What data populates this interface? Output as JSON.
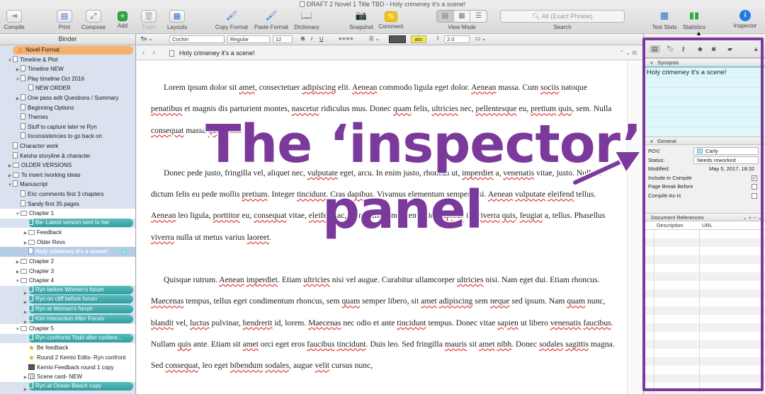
{
  "window": {
    "title": "DRAFT 2 Novel 1 Title TBD - Holy crimeney it's a scene!"
  },
  "toolbar": {
    "compile": "Compile",
    "print": "Print",
    "compose": "Compose",
    "add": "Add",
    "trash": "Trash",
    "layouts": "Layouts",
    "copy_format": "Copy Format",
    "paste_format": "Paste Format",
    "dictionary": "Dictionary",
    "snapshot": "Snapshot",
    "comment": "Comment",
    "view_mode": "View Mode",
    "search_placeholder": "All (Exact Phrase)",
    "search_label": "Search",
    "text_stats": "Text Stats",
    "statistics": "Statistics",
    "inspector": "Inspector",
    "icons": {
      "compile": "compile-icon",
      "print": "printer-icon",
      "compose": "compose-icon",
      "add": "plus-icon",
      "trash": "trash-icon",
      "layouts": "layouts-icon",
      "copy_format": "brush-icon",
      "paste_format": "brush-icon",
      "dictionary": "book-icon",
      "snapshot": "camera-icon",
      "comment": "speech-bubble-icon",
      "text_stats": "calculator-icon",
      "statistics": "bar-chart-icon",
      "inspector": "info-icon"
    }
  },
  "binder": {
    "title": "Binder",
    "items": [
      {
        "label": "Novel Format",
        "indent": 0,
        "disc": "",
        "icon": "warn",
        "style": "pill-orange"
      },
      {
        "label": "Timeline & Plot",
        "indent": 0,
        "disc": "▼",
        "icon": "doc",
        "style": ""
      },
      {
        "label": "Timeline NEW",
        "indent": 1,
        "disc": "▶",
        "icon": "doc",
        "style": ""
      },
      {
        "label": "Play timeline Oct 2016",
        "indent": 1,
        "disc": "▼",
        "icon": "doc",
        "style": ""
      },
      {
        "label": "NEW ORDER",
        "indent": 2,
        "disc": "",
        "icon": "doc",
        "style": ""
      },
      {
        "label": "One pass edit Questions / Summary",
        "indent": 1,
        "disc": "▶",
        "icon": "doc",
        "style": ""
      },
      {
        "label": "Beginning Options",
        "indent": 1,
        "disc": "",
        "icon": "doc",
        "style": ""
      },
      {
        "label": "Themes",
        "indent": 1,
        "disc": "",
        "icon": "doc",
        "style": ""
      },
      {
        "label": "Stuff to capture later re Ryn",
        "indent": 1,
        "disc": "",
        "icon": "doc",
        "style": ""
      },
      {
        "label": "Inconsistencies to go back on",
        "indent": 1,
        "disc": "",
        "icon": "doc",
        "style": ""
      },
      {
        "label": "Character work",
        "indent": 0,
        "disc": "",
        "icon": "doc",
        "style": ""
      },
      {
        "label": "Keisha storyline & character",
        "indent": 0,
        "disc": "",
        "icon": "doc",
        "style": ""
      },
      {
        "label": "OLDER VERSIONS",
        "indent": 0,
        "disc": "▶",
        "icon": "folder",
        "style": ""
      },
      {
        "label": "To insert /working ideas",
        "indent": 0,
        "disc": "▶",
        "icon": "folder",
        "style": ""
      },
      {
        "label": "Manuscript",
        "indent": 0,
        "disc": "▼",
        "icon": "doc",
        "style": ""
      },
      {
        "label": "Eric comments first 3 chapters",
        "indent": 1,
        "disc": "",
        "icon": "doc",
        "style": ""
      },
      {
        "label": "Sandy first 35 pages",
        "indent": 1,
        "disc": "",
        "icon": "doc",
        "style": ""
      },
      {
        "label": "Chapter 1",
        "indent": 1,
        "disc": "▼",
        "icon": "folder",
        "style": "white-row"
      },
      {
        "label": "Be- Latest version sent to her",
        "indent": 2,
        "disc": "",
        "icon": "doc",
        "style": "pill-teal"
      },
      {
        "label": "Feedback",
        "indent": 2,
        "disc": "▶",
        "icon": "folder",
        "style": "white-row"
      },
      {
        "label": "Older Revs",
        "indent": 2,
        "disc": "▶",
        "icon": "folder",
        "style": "white-row"
      },
      {
        "label": "Holy crimeney it's a scene!",
        "indent": 2,
        "disc": "",
        "icon": "blue",
        "style": "selected"
      },
      {
        "label": "Chapter 2",
        "indent": 1,
        "disc": "▶",
        "icon": "folder",
        "style": "white-row"
      },
      {
        "label": "Chapter 3",
        "indent": 1,
        "disc": "▶",
        "icon": "folder",
        "style": "white-row"
      },
      {
        "label": "Chapter 4",
        "indent": 1,
        "disc": "▼",
        "icon": "folder",
        "style": "white-row"
      },
      {
        "label": "Ryn before Women's forum",
        "indent": 2,
        "disc": "▶",
        "icon": "doc",
        "style": "pill-teal"
      },
      {
        "label": "Ryn on cliff before forum",
        "indent": 2,
        "disc": "▶",
        "icon": "doc",
        "style": "pill-teal"
      },
      {
        "label": "Ryn at Woman's forum",
        "indent": 2,
        "disc": "▶",
        "icon": "doc",
        "style": "pill-teal"
      },
      {
        "label": "Kim Interaction After Forum",
        "indent": 2,
        "disc": "▶",
        "icon": "doc",
        "style": "pill-teal"
      },
      {
        "label": "Chapter 5",
        "indent": 1,
        "disc": "▼",
        "icon": "folder",
        "style": "white-row"
      },
      {
        "label": "Ryn confronts Todd after confere...",
        "indent": 2,
        "disc": "",
        "icon": "doc",
        "style": "pill-teal"
      },
      {
        "label": "Be feedback",
        "indent": 2,
        "disc": "",
        "icon": "star",
        "style": "white-row"
      },
      {
        "label": "Round 2 Kemio Edits- Ryn confront",
        "indent": 2,
        "disc": "",
        "icon": "star",
        "style": "white-row"
      },
      {
        "label": "Kemio Feedback round 1 copy",
        "indent": 2,
        "disc": "",
        "icon": "dark",
        "style": "white-row"
      },
      {
        "label": "Scene card- NEW",
        "indent": 2,
        "disc": "▶",
        "icon": "grid",
        "style": "white-row"
      },
      {
        "label": "Ryn at Ocean Beach copy",
        "indent": 2,
        "disc": "▶",
        "icon": "doc",
        "style": "pill-teal"
      }
    ]
  },
  "format_bar": {
    "paragraph_style": "¶a",
    "font": "Cochin",
    "weight": "Regular",
    "size": "12",
    "bold": "B",
    "italic": "I",
    "underline": "U",
    "highlight": "abc",
    "line_spacing": "2.0"
  },
  "editor": {
    "doc_title": "Holy crimeney it's a scene!",
    "paragraphs": [
      "Lorem ipsum dolor sit amet, consectetuer adipiscing elit. Aenean commodo ligula eget dolor. Aenean massa. Cum sociis natoque penatibus et magnis dis parturient montes, nascetur ridiculus mus. Donec quam felis, ultricies nec, pellentesque eu, pretium quis, sem. Nulla consequat massa quis enim.",
      "Donec pede justo, fringilla vel, aliquet nec, vulputate eget, arcu. In enim justo, rhoncus ut, imperdiet a, venenatis vitae, justo. Nullam dictum felis eu pede mollis pretium. Integer tincidunt. Cras dapibus. Vivamus elementum semper nisi. Aenean vulputate eleifend tellus. Aenean leo ligula, porttitor eu, consequat vitae, eleifend ac, enim. Aliquam lorem ante, dapibus in, viverra quis, feugiat a, tellus. Phasellus viverra nulla ut metus varius laoreet.",
      "Quisque rutrum. Aenean imperdiet. Etiam ultricies nisi vel augue. Curabitur ullamcorper ultricies nisi. Nam eget dui. Etiam rhoncus. Maecenas tempus, tellus eget condimentum rhoncus, sem quam semper libero, sit amet adipiscing sem neque sed ipsum. Nam quam nunc, blandit vel, luctus pulvinar, hendrerit id, lorem. Maecenas nec odio et ante tincidunt tempus. Donec vitae sapien ut libero venenatis faucibus. Nullam quis ante. Etiam sit amet orci eget eros faucibus tincidunt. Duis leo. Sed fringilla mauris sit amet nibh. Donec sodales sagittis magna. Sed consequat, leo eget bibendum sodales, augue velit cursus nunc,"
    ]
  },
  "inspector": {
    "synopsis_label": "Synopsis",
    "synopsis_text": "Holy crimeney it's a scene!",
    "general_label": "General",
    "pov_label": "POV:",
    "pov_value": "Carly",
    "status_label": "Status:",
    "status_value": "Needs reworked",
    "modified_label": "Modified:",
    "modified_value": "May 5, 2017, 18:32",
    "include_compile": "Include in Compile",
    "page_break": "Page Break Before",
    "compile_as_is": "Compile As-Is",
    "refs_label": "Document References",
    "col_description": "Description",
    "col_url": "URL"
  },
  "annotation": {
    "line1": "The ‘inspector’",
    "line2": "panel",
    "color": "#7b3a9b"
  }
}
